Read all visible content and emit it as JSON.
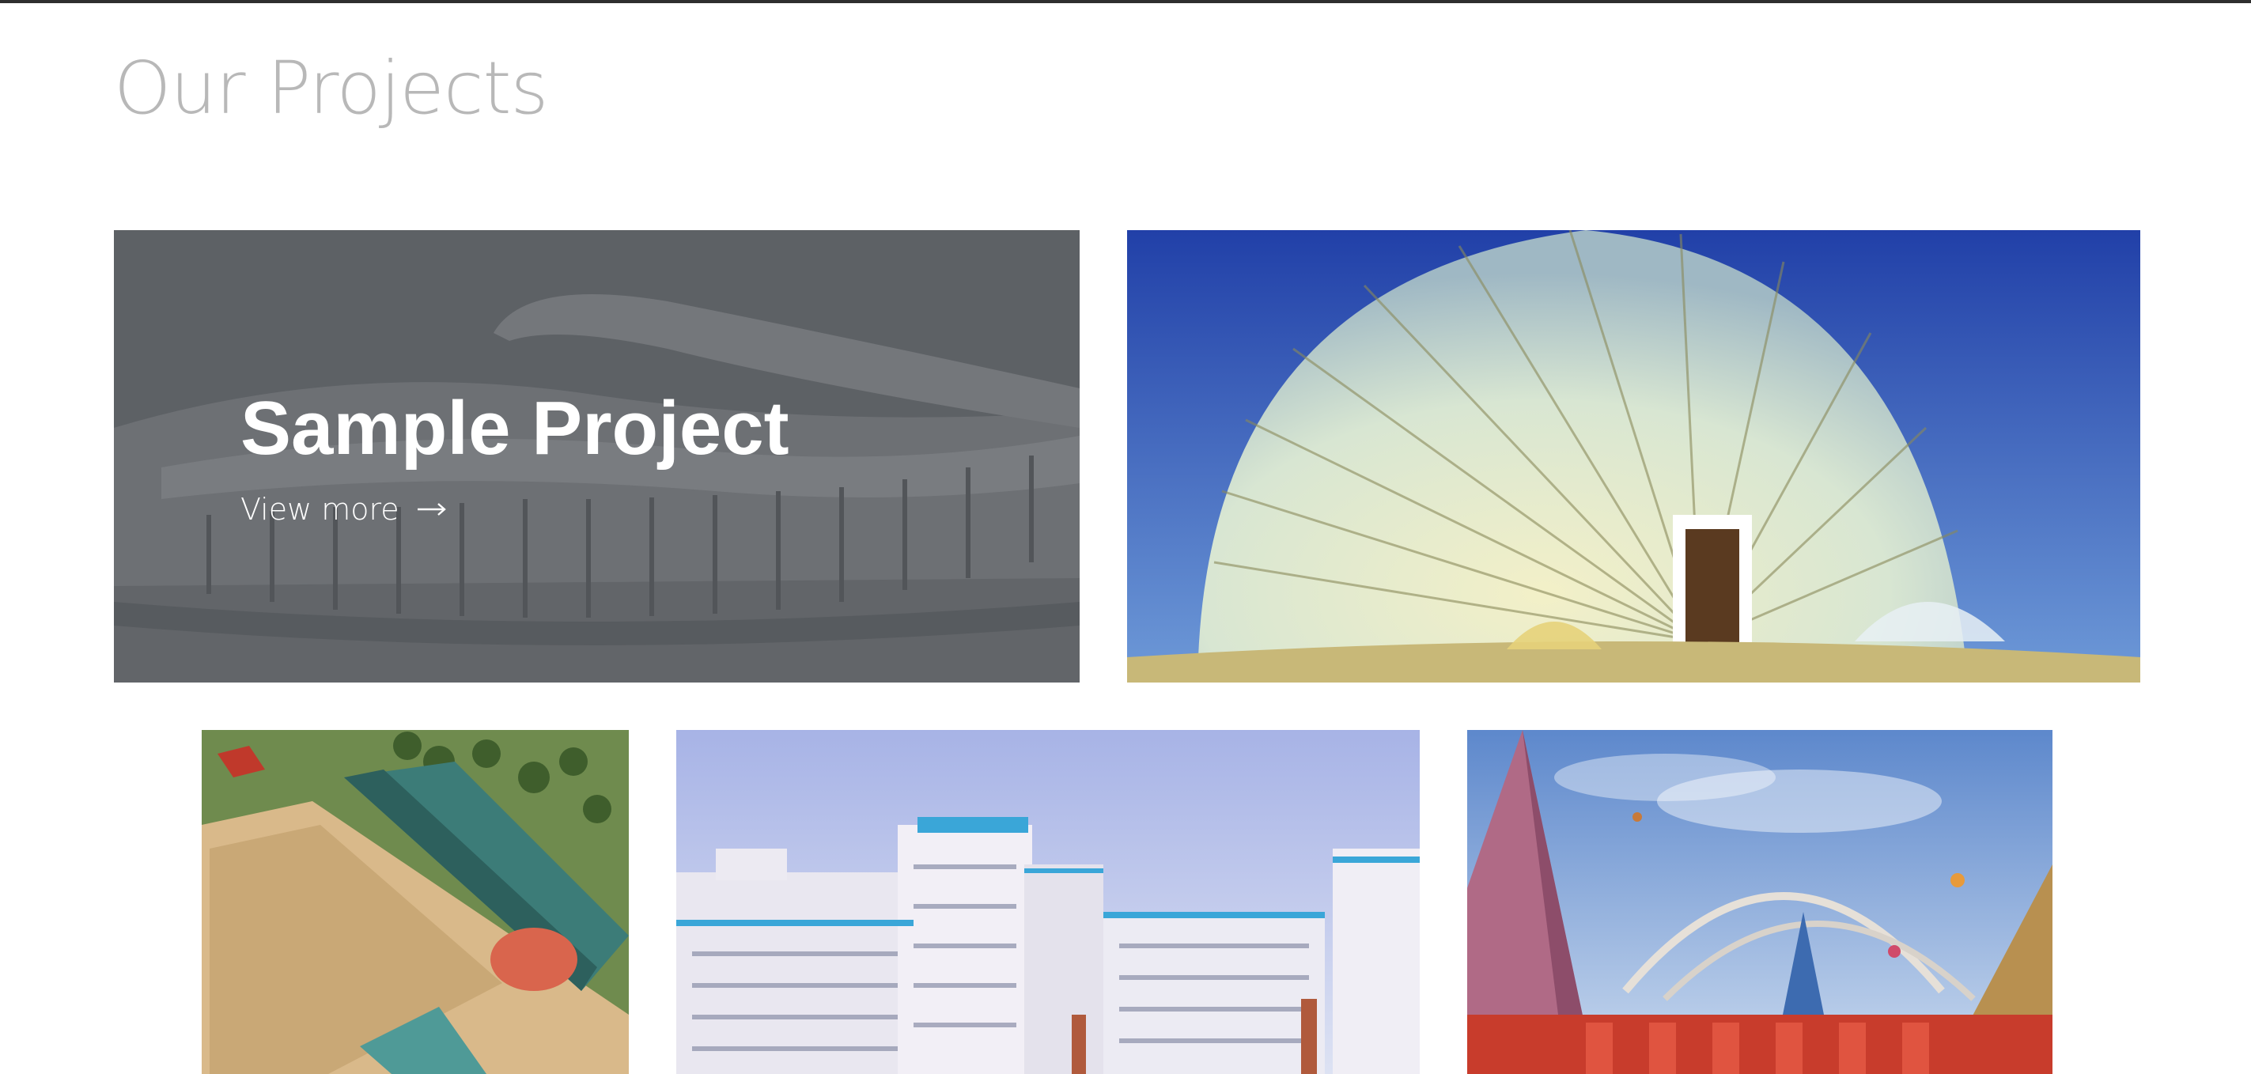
{
  "page": {
    "title": "Our Projects"
  },
  "projects": [
    {
      "title": "Sample Project",
      "link_label": "View more",
      "link_icon": "arrow-right-icon",
      "illustration": "stadium-rendering"
    },
    {
      "illustration": "glass-dome-rendering"
    },
    {
      "illustration": "aerial-sports-complex-rendering"
    },
    {
      "illustration": "residential-towers-rendering"
    },
    {
      "illustration": "monument-arches-rendering"
    }
  ],
  "colors": {
    "title": "#b8b8b8",
    "overlay": "#40444880",
    "top_rule": "#2f2f2f",
    "sky_blue": "#2f4fb0"
  }
}
